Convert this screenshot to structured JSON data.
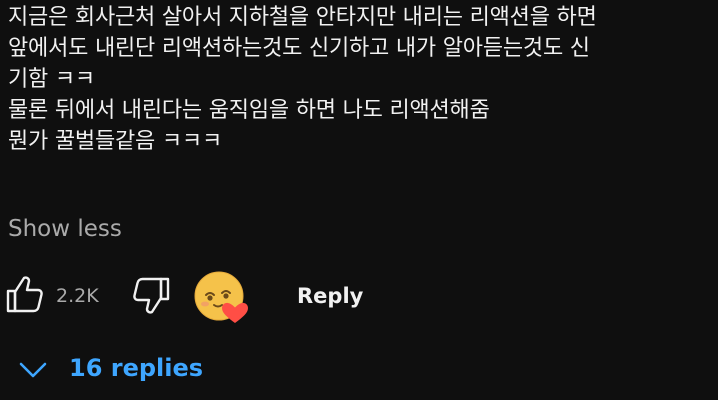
{
  "comment": {
    "lines": [
      "지금은 회사근처 살아서 지하철을 안타지만 내리는 리액션을 하면",
      "앞에서도 내린단 리액션하는것도 신기하고 내가 알아듣는것도 신",
      "기함 ㅋㅋ",
      "물론 뒤에서 내린다는 움직임을 하면 나도 리액션해줌",
      "뭔가 꿀벌들같음 ㅋㅋㅋ"
    ],
    "show_less_label": "Show less"
  },
  "actions": {
    "like_icon": "thumbs-up-icon",
    "like_count": "2.2K",
    "dislike_icon": "thumbs-down-icon",
    "creator_heart_icon": "creator-heart-avatar-icon",
    "reply_label": "Reply"
  },
  "replies": {
    "chevron_icon": "chevron-down-icon",
    "label": "16 replies"
  },
  "colors": {
    "background": "#0f0f0f",
    "text": "#f1f1f1",
    "secondary_text": "#aaaaaa",
    "link": "#3ea6ff",
    "heart": "#ff4e45"
  }
}
